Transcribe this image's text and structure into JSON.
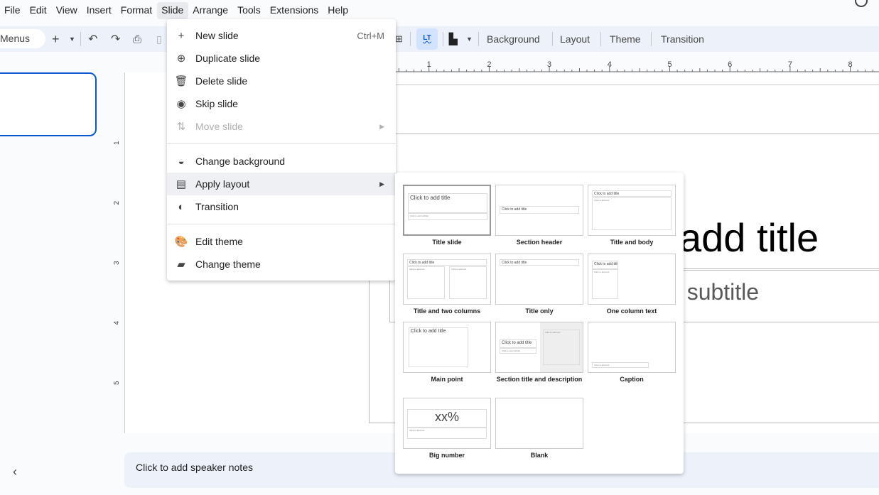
{
  "menubar": {
    "items": [
      "File",
      "Edit",
      "View",
      "Insert",
      "Format",
      "Slide",
      "Arrange",
      "Tools",
      "Extensions",
      "Help"
    ],
    "active": "Slide"
  },
  "toolbar": {
    "menus_label": "Menus",
    "buttons": [
      "Background",
      "Layout",
      "Theme",
      "Transition"
    ]
  },
  "ruler": {
    "h_ticks": [
      "1",
      "2",
      "3",
      "4",
      "5",
      "6",
      "7",
      "8"
    ],
    "v_ticks": [
      "1",
      "2",
      "3",
      "4",
      "5"
    ]
  },
  "slide": {
    "title_fragment": "add title",
    "subtitle_fragment": "d subtitle"
  },
  "notes": {
    "placeholder": "Click to add speaker notes"
  },
  "slide_menu": {
    "items": [
      {
        "label": "New slide",
        "icon": "plus-icon",
        "shortcut": "Ctrl+M"
      },
      {
        "label": "Duplicate slide",
        "icon": "duplicate-icon"
      },
      {
        "label": "Delete slide",
        "icon": "trash-icon"
      },
      {
        "label": "Skip slide",
        "icon": "eye-icon"
      },
      {
        "label": "Move slide",
        "icon": "move-icon",
        "disabled": true,
        "submenu": true
      },
      {
        "label": "Change background",
        "icon": "background-icon"
      },
      {
        "label": "Apply layout",
        "icon": "layout-icon",
        "submenu": true,
        "highlighted": true
      },
      {
        "label": "Transition",
        "icon": "transition-icon"
      },
      {
        "label": "Edit theme",
        "icon": "palette-icon"
      },
      {
        "label": "Change theme",
        "icon": "paint-roller-icon"
      }
    ]
  },
  "layouts": {
    "placeholder_title": "Click to add title",
    "placeholder_subtitle": "Click to add subtitle",
    "placeholder_text": "Click to add text",
    "big_number": "xx%",
    "items": [
      "Title slide",
      "Section header",
      "Title and body",
      "Title and two columns",
      "Title only",
      "One column text",
      "Main point",
      "Section title and description",
      "Caption",
      "Big number",
      "Blank"
    ],
    "selected": "Title slide"
  }
}
